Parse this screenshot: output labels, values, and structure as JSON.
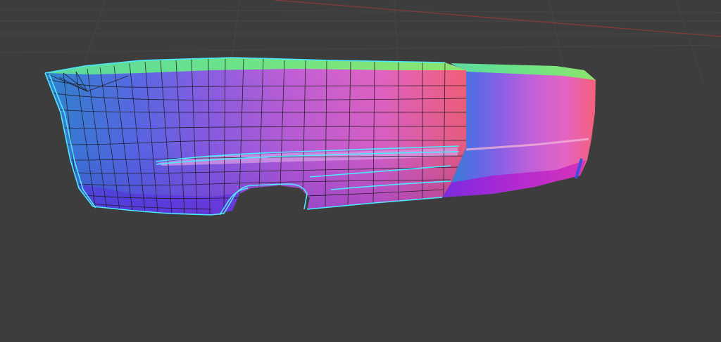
{
  "viewport": {
    "mode": "edit",
    "shading": "normal-map",
    "object": "car-rear-bumper-mesh",
    "colors": {
      "background": "#3d3d3d",
      "grid_line": "#464646",
      "x_axis": "#8a3a3a",
      "selection_outline": "#4ee8ff",
      "wireframe": "#1a1a1a",
      "normal_blue": "#3a4fd8",
      "normal_cyan": "#3b8fd6",
      "normal_violet": "#9a5de0",
      "normal_pink": "#e066c8",
      "normal_red": "#f25a7a",
      "normal_green": "#63e08a"
    }
  }
}
